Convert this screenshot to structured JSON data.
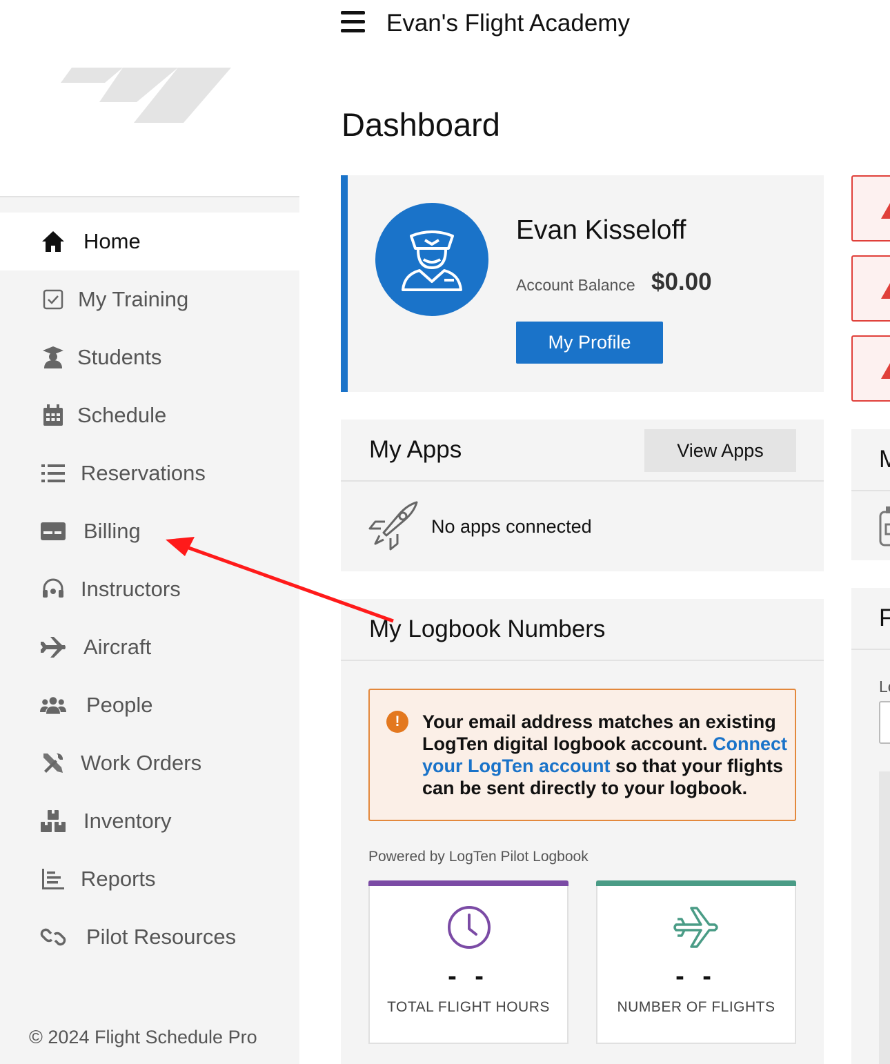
{
  "header": {
    "app_title": "Evan's Flight Academy",
    "menu_icon": "hamburger-menu-icon"
  },
  "sidebar": {
    "items": [
      {
        "label": "Home",
        "icon": "home-icon",
        "active": true
      },
      {
        "label": "My Training",
        "icon": "checkbox-icon"
      },
      {
        "label": "Students",
        "icon": "student-icon"
      },
      {
        "label": "Schedule",
        "icon": "calendar-icon"
      },
      {
        "label": "Reservations",
        "icon": "list-icon"
      },
      {
        "label": "Billing",
        "icon": "credit-card-icon"
      },
      {
        "label": "Instructors",
        "icon": "headset-icon"
      },
      {
        "label": "Aircraft",
        "icon": "airplane-icon"
      },
      {
        "label": "People",
        "icon": "people-icon"
      },
      {
        "label": "Work Orders",
        "icon": "tools-icon"
      },
      {
        "label": "Inventory",
        "icon": "boxes-icon"
      },
      {
        "label": "Reports",
        "icon": "bar-chart-icon"
      },
      {
        "label": "Pilot Resources",
        "icon": "link-icon"
      }
    ],
    "copyright": "© 2024 Flight Schedule Pro"
  },
  "main": {
    "page_title": "Dashboard",
    "profile": {
      "name": "Evan Kisseloff",
      "balance_label": "Account Balance",
      "balance_value": "$0.00",
      "profile_button": "My Profile"
    },
    "apps": {
      "title": "My Apps",
      "view_button": "View Apps",
      "empty_text": "No apps connected"
    },
    "logbook": {
      "title": "My Logbook Numbers",
      "notice_pre": "Your email address matches an existing LogTen digital logbook account. ",
      "notice_link": "Connect your LogTen account",
      "notice_post": " so that your flights can be sent directly to your logbook.",
      "powered_by": "Powered by LogTen Pilot Logbook",
      "stats": [
        {
          "value": "- -",
          "label": "TOTAL FLIGHT HOURS",
          "color": "#7b4ba5"
        },
        {
          "value": "- -",
          "label": "NUMBER OF FLIGHTS",
          "color": "#4a9c86"
        }
      ]
    },
    "right_column": {
      "card1_letter": "M",
      "card2_letter": "F",
      "card2_sub": "Lo"
    }
  },
  "colors": {
    "brand_blue": "#1a73c9",
    "alert_red": "#e0403a",
    "notice_orange": "#e3883c",
    "annotation_arrow": "#ff1a1a"
  }
}
